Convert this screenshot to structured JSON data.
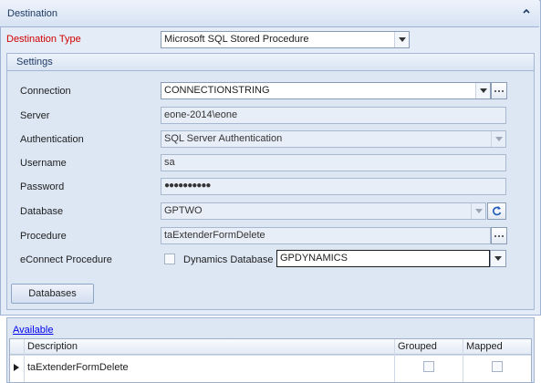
{
  "destination_group": {
    "title": "Destination",
    "collapse_icon": "chevron-up-icon"
  },
  "destination_type": {
    "label": "Destination Type",
    "value": "Microsoft SQL Stored Procedure"
  },
  "settings": {
    "title": "Settings",
    "connection": {
      "label": "Connection",
      "value": "CONNECTIONSTRING"
    },
    "server": {
      "label": "Server",
      "value": "eone-2014\\eone"
    },
    "authentication": {
      "label": "Authentication",
      "value": "SQL Server Authentication"
    },
    "username": {
      "label": "Username",
      "value": "sa"
    },
    "password": {
      "label": "Password",
      "value": "●●●●●●●●●●"
    },
    "database": {
      "label": "Database",
      "value": "GPTWO",
      "refresh_icon": "refresh-icon"
    },
    "procedure": {
      "label": "Procedure",
      "value": "taExtenderFormDelete"
    },
    "econnect": {
      "label": "eConnect Procedure",
      "checkbox_label": "Dynamics Database",
      "checked": false,
      "dynamics_db_value": "GPDYNAMICS"
    },
    "databases_button": "Databases"
  },
  "available": {
    "link": "Available",
    "columns": [
      "Description",
      "Grouped",
      "Mapped"
    ],
    "rows": [
      {
        "description": "taExtenderFormDelete",
        "grouped": false,
        "mapped": false
      }
    ]
  },
  "colors": {
    "required_label": "#d00000",
    "group_background": "#dde7f4",
    "link": "#0000ee"
  }
}
